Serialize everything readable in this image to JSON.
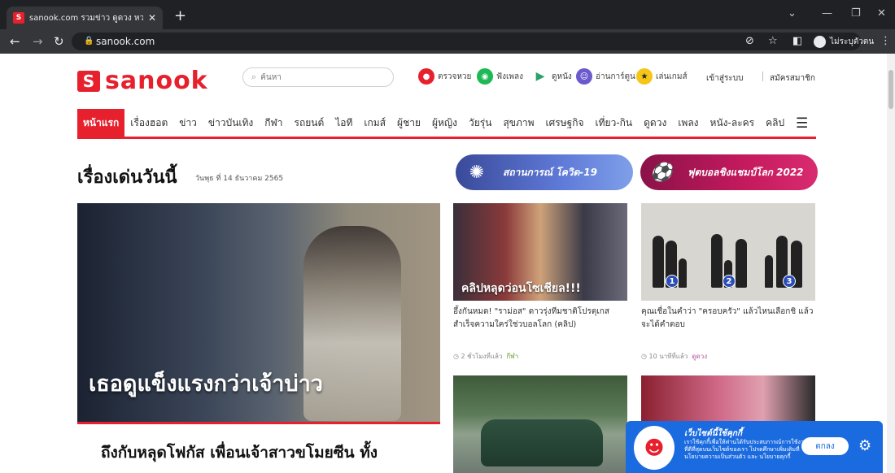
{
  "browser": {
    "tab_title": "sanook.com รวมข่าว ดูดวง หวย ผลบ",
    "url": "sanook.com",
    "profile_label": "ไม่ระบุตัวตน"
  },
  "header": {
    "logo_text": "sanook",
    "search_placeholder": "ค้นหา",
    "services": [
      {
        "label": "ตรวจหวย",
        "color": "#e7202d"
      },
      {
        "label": "ฟังเพลง",
        "color": "#1db954"
      },
      {
        "label": "ดูหนัง",
        "color": "#f0a020"
      },
      {
        "label": "อ่านการ์ตูน",
        "color": "#6a5acd"
      },
      {
        "label": "เล่นเกมส์",
        "color": "#f5c518"
      }
    ],
    "login": "เข้าสู่ระบบ",
    "register": "สมัครสมาชิก"
  },
  "nav": {
    "items": [
      "หน้าแรก",
      "เรื่องฮอต",
      "ข่าว",
      "ข่าวบันเทิง",
      "กีฬา",
      "รถยนต์",
      "ไอที",
      "เกมส์",
      "ผู้ชาย",
      "ผู้หญิง",
      "วัยรุ่น",
      "สุขภาพ",
      "เศรษฐกิจ",
      "เที่ยว-กิน",
      "ดูดวง",
      "เพลง",
      "หนัง-ละคร",
      "คลิป"
    ]
  },
  "section": {
    "title": "เรื่องเด่นวันนี้",
    "date": "วันพุธ ที่ 14 ธันวาคม 2565",
    "pill_covid": "สถานการณ์ โควิด-19",
    "pill_worldcup": "ฟุตบอลชิงแชมป์โลก 2022"
  },
  "hero": {
    "image_caption": "เธอดูแข็งแรงกว่าเจ้าบ่าว",
    "title": "ถึงกับหลุดโฟกัส เพื่อนเจ้าสาวขโมยซีน ทั้ง"
  },
  "cards": [
    {
      "overlay": "คลิปหลุดว่อนโซเชียล!!!",
      "text": "อึ้งกันหมด! \"ราม่อส\" ดาวรุ่งทีมชาติโปรตุเกส สำเร็จความใคร่ใช่วบอลโลก (คลิป)",
      "time": "◷ 2 ชั่วโมงที่แล้ว",
      "category": "กีฬา"
    },
    {
      "numbers": [
        "1",
        "2",
        "3"
      ],
      "text": "คุณเชื่อในคำว่า \"ครอบครัว\" แล้วไหนเลือกชิ แล้วจะได้คำตอบ",
      "time": "◷ 10 นาทีที่แล้ว",
      "category": "ดูดวง"
    }
  ],
  "cookie": {
    "heading": "เว็บไซต์นี้ใช้คุกกี้",
    "body": "เราใช้คุกกี้เพื่อให้ท่านได้รับประสบการณ์การใช้งานที่ดีที่สุดบนเว็บไซต์ของเรา โปรดศึกษาเพิ่มเติมที่ นโยบายความเป็นส่วนตัว และ นโยบายคุกกี้",
    "button": "ตกลง"
  }
}
